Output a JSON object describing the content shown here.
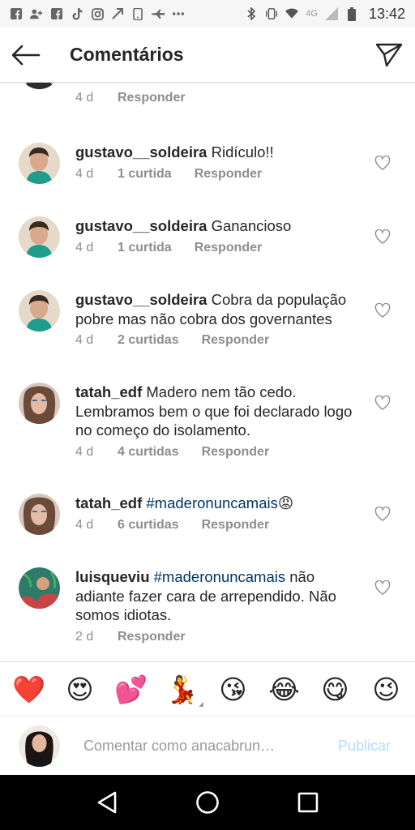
{
  "status_bar": {
    "time": "13:42",
    "network": "4G",
    "left_icons": [
      "facebook-icon",
      "add-user-icon",
      "facebook-icon",
      "tiktok-icon",
      "instagram-icon",
      "cast-icon",
      "phone-icon",
      "airplane-icon",
      "more-dots-icon"
    ],
    "right_icons": [
      "bluetooth-icon",
      "vibrate-icon",
      "wifi-icon",
      "signal-icon",
      "battery-icon"
    ]
  },
  "header": {
    "title": "Comentários"
  },
  "comments": [
    {
      "age": "4 d",
      "likes": "",
      "reply": "Responder"
    },
    {
      "user": "gustavo__soldeira",
      "text": "Ridículo!!",
      "age": "4 d",
      "likes": "1 curtida",
      "reply": "Responder"
    },
    {
      "user": "gustavo__soldeira",
      "text": "Ganancioso",
      "age": "4 d",
      "likes": "1 curtida",
      "reply": "Responder"
    },
    {
      "user": "gustavo__soldeira",
      "text": "Cobra da população pobre mas não cobra dos governantes",
      "age": "4 d",
      "likes": "2 curtidas",
      "reply": "Responder"
    },
    {
      "user": "tatah_edf",
      "text": "Madero nem tão cedo. Lembramos bem o que foi declarado logo no começo do isolamento.",
      "age": "4 d",
      "likes": "4 curtidas",
      "reply": "Responder"
    },
    {
      "user": "tatah_edf",
      "hashtag": "#maderonuncamais",
      "text": "😡",
      "age": "4 d",
      "likes": "6 curtidas",
      "reply": "Responder"
    },
    {
      "user": "luisqueviu",
      "hashtag": "#maderonuncamais",
      "text": "não adiante fazer cara de arrependido. Não somos idiotas.",
      "age": "2 d",
      "likes": "",
      "reply": "Responder"
    }
  ],
  "emoji_bar": {
    "emojis": [
      "❤️",
      "😍",
      "💕",
      "💃",
      "😘",
      "😂",
      "😋",
      "😉"
    ]
  },
  "comment_input": {
    "placeholder": "Comentar como anacabrun…",
    "publish_label": "Publicar"
  },
  "colors": {
    "hashtag": "#003569",
    "meta_grey": "#8e8e8e",
    "publish_disabled": "#b3dbff"
  }
}
